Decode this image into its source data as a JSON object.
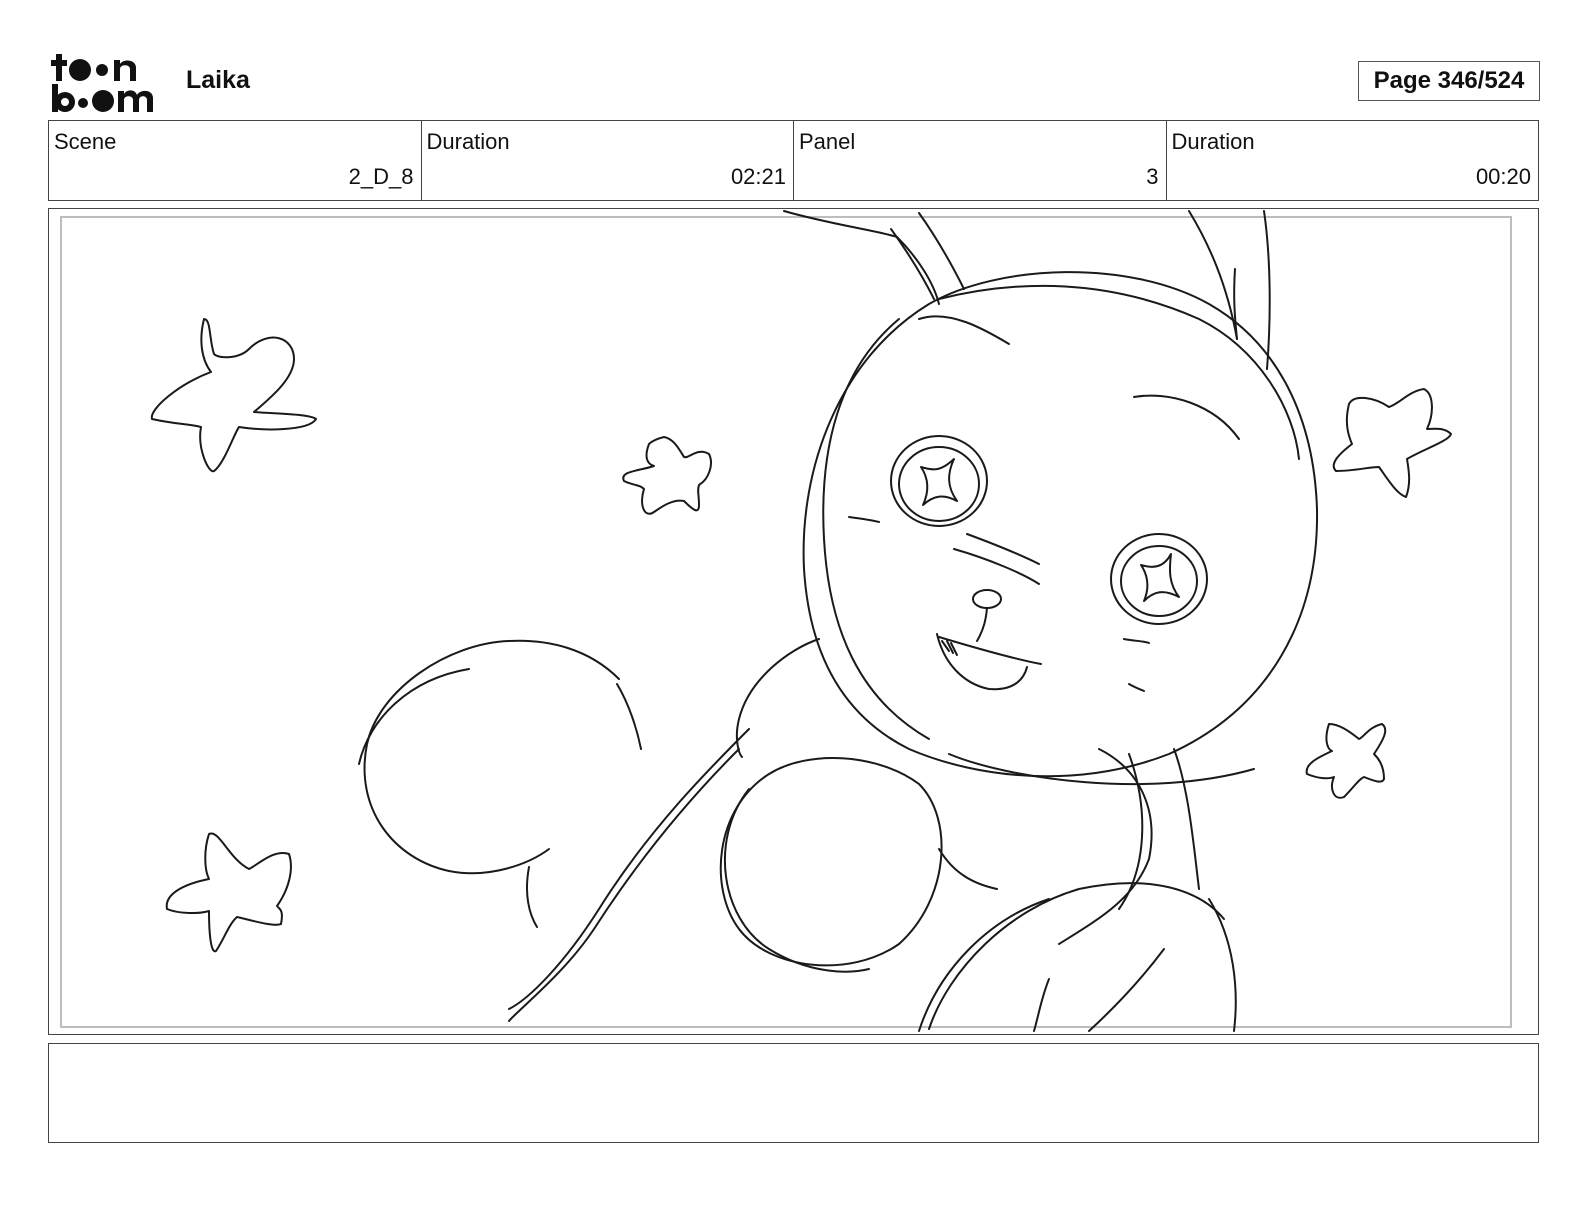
{
  "header": {
    "logo": {
      "line1": "toon",
      "line2": "boom",
      "icon": "toon-boom-logo"
    },
    "project_title": "Laika",
    "page_indicator": "Page 346/524"
  },
  "info_bar": {
    "scene_label": "Scene",
    "scene_value": "2_D_8",
    "scene_duration_label": "Duration",
    "scene_duration_value": "02:21",
    "panel_label": "Panel",
    "panel_value": "3",
    "panel_duration_label": "Duration",
    "panel_duration_value": "00:20"
  },
  "panel": {
    "drawing": "pencil-sketch-of-cartoon-creature-with-stars",
    "icons": [
      "star-doodle-icon"
    ]
  },
  "notes": {
    "text": ""
  }
}
